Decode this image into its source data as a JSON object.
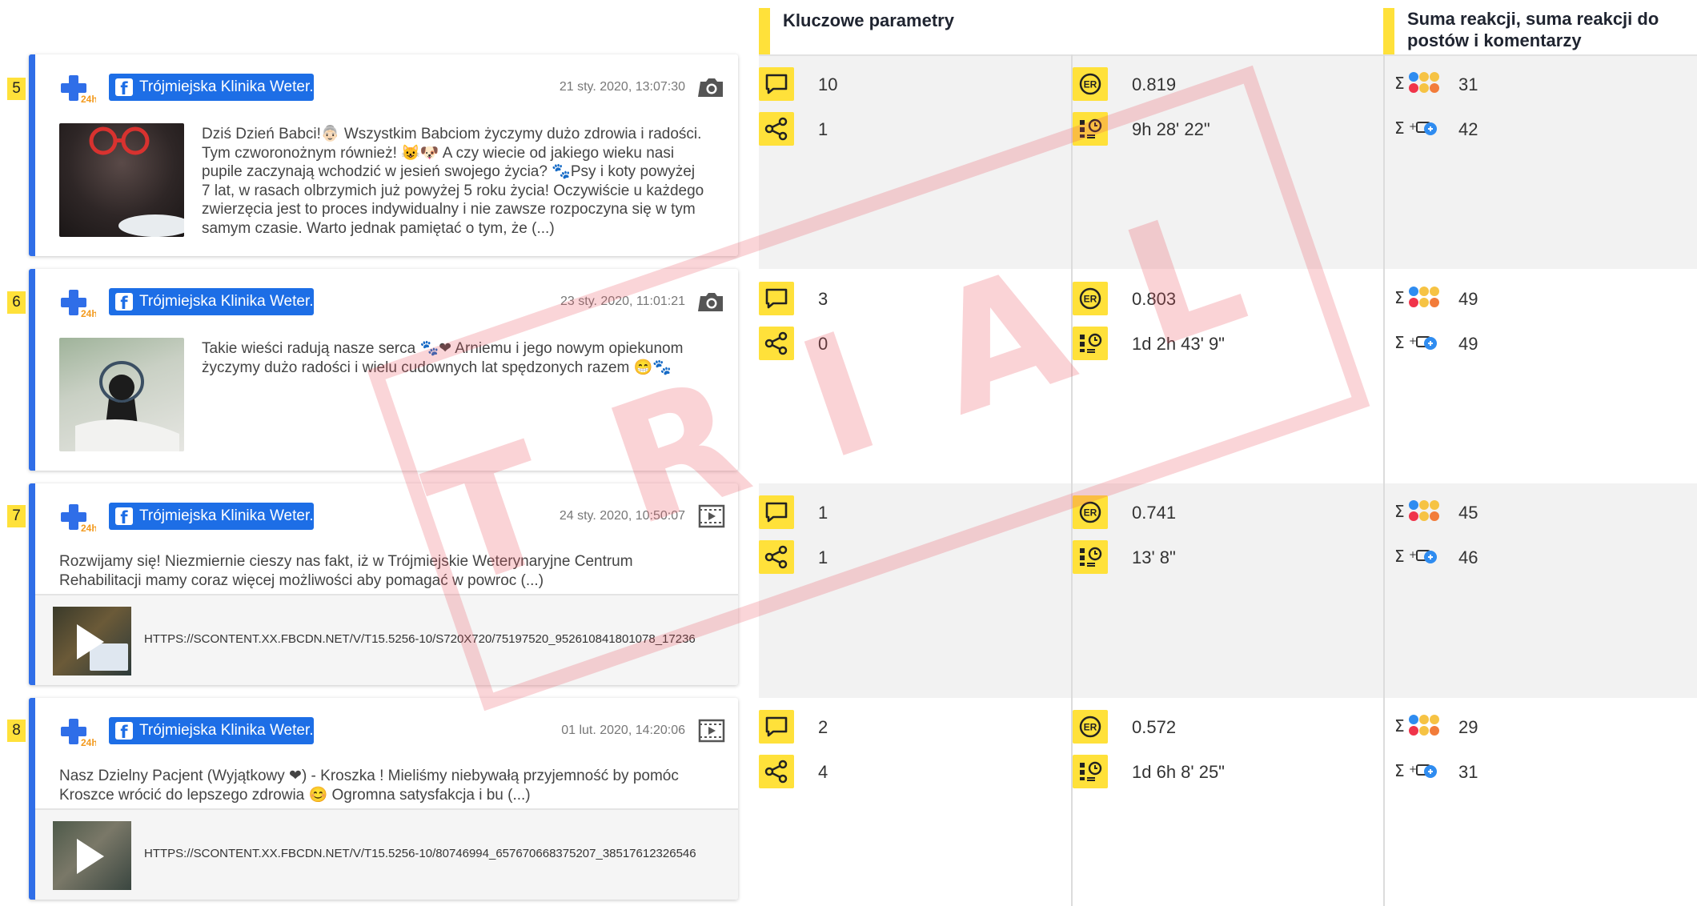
{
  "header": {
    "params_title": "Kluczowe parametry",
    "reactions_title": "Suma reakcji, suma reakcji do postów i komentarzy"
  },
  "colors": {
    "accent": "#ffe13a",
    "facebook": "#1d6ee6",
    "card_border": "#2f6ee8",
    "watermark": "#ec505a"
  },
  "watermark": "TRIAL",
  "posts": [
    {
      "index": "5",
      "page_name": "Trójmiejska Klinika Weter...",
      "date": "21 sty. 2020, 13:07:30",
      "media_icon": "camera-icon",
      "text": "Dziś Dzień Babci!👵🏻 Wszystkim Babciom życzymy dużo zdrowia i radości. Tym czworonożnym również! 😺🐶 A czy wiecie od jakiego wieku nasi pupile zaczynają wchodzić w jesień swojego życia? 🐾Psy i koty powyżej 7 lat, w rasach olbrzymich już powyżej 5 roku życia! Oczywiście u każdego zwierzęcia jest to proces indywidualny i nie zawsze rozpoczyna się w tym samym czasie. Warto jednak pamiętać o tym, że (...)",
      "comments": "10",
      "shares": "1",
      "er": "0.819",
      "time": "9h 28' 22\"",
      "reactions_sum": "31",
      "reactions_posts_comments": "42"
    },
    {
      "index": "6",
      "page_name": "Trójmiejska Klinika Weter...",
      "date": "23 sty. 2020, 11:01:21",
      "media_icon": "camera-icon",
      "text": "Takie wieści radują nasze serca 🐾❤ Arniemu i jego nowym opiekunom życzymy dużo radości i wielu cudownych lat spędzonych razem 😁🐾",
      "comments": "3",
      "shares": "0",
      "er": "0.803",
      "time": "1d 2h 43' 9\"",
      "reactions_sum": "49",
      "reactions_posts_comments": "49"
    },
    {
      "index": "7",
      "page_name": "Trójmiejska Klinika Weter...",
      "date": "24 sty. 2020, 10:50:07",
      "media_icon": "video-icon",
      "text": "Rozwijamy się! Niezmiernie cieszy nas fakt, iż w Trójmiejskie Weterynaryjne Centrum Rehabilitacji mamy coraz więcej możliwości aby pomagać w powroc (...)",
      "link": "HTTPS://SCONTENT.XX.FBCDN.NET/V/T15.5256-10/S720X720/75197520_952610841801078_17236",
      "comments": "1",
      "shares": "1",
      "er": "0.741",
      "time": "13' 8\"",
      "reactions_sum": "45",
      "reactions_posts_comments": "46"
    },
    {
      "index": "8",
      "page_name": "Trójmiejska Klinika Weter...",
      "date": "01 lut. 2020, 14:20:06",
      "media_icon": "video-icon",
      "text": "Nasz Dzielny Pacjent (Wyjątkowy ❤) - Kroszka ! Mieliśmy niebywałą przyjemność by pomóc Kroszce wrócić do lepszego zdrowia 😊 Ogromna satysfakcja i bu (...)",
      "link": "HTTPS://SCONTENT.XX.FBCDN.NET/V/T15.5256-10/80746994_657670668375207_38517612326546",
      "comments": "2",
      "shares": "4",
      "er": "0.572",
      "time": "1d 6h 8' 25\"",
      "reactions_sum": "29",
      "reactions_posts_comments": "31"
    }
  ]
}
